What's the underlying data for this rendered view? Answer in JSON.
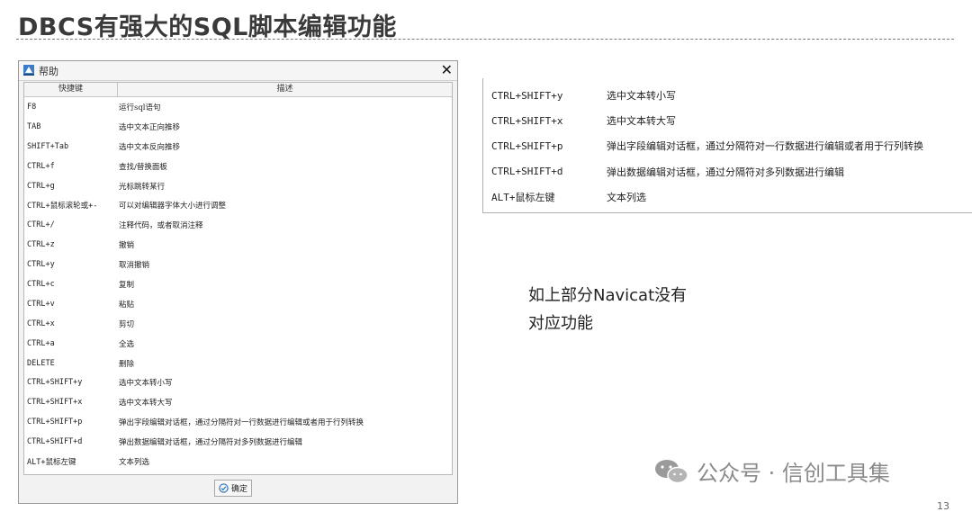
{
  "slide": {
    "title": "DBCS有强大的SQL脚本编辑功能",
    "note_line1": "如上部分Navicat没有",
    "note_line2": "对应功能",
    "watermark": "公众号 · 信创工具集",
    "page_number": "13"
  },
  "dialog": {
    "title": "帮助",
    "close_glyph": "✕",
    "header_key": "快捷键",
    "header_desc": "描述",
    "ok_label": "确定",
    "rows": [
      {
        "key": "F8",
        "desc": "运行sql语句"
      },
      {
        "key": "TAB",
        "desc": "选中文本正向推移"
      },
      {
        "key": "SHIFT+Tab",
        "desc": "选中文本反向推移"
      },
      {
        "key": "CTRL+f",
        "desc": "查找/替换面板"
      },
      {
        "key": "CTRL+g",
        "desc": "光标跳转某行"
      },
      {
        "key": "CTRL+鼠标滚轮或+-",
        "desc": "可以对编辑器字体大小进行调整"
      },
      {
        "key": "CTRL+/",
        "desc": "注释代码，或者取消注释"
      },
      {
        "key": "CTRL+z",
        "desc": "撤销"
      },
      {
        "key": "CTRL+y",
        "desc": "取消撤销"
      },
      {
        "key": "CTRL+c",
        "desc": "复制"
      },
      {
        "key": "CTRL+v",
        "desc": "粘贴"
      },
      {
        "key": "CTRL+x",
        "desc": "剪切"
      },
      {
        "key": "CTRL+a",
        "desc": "全选"
      },
      {
        "key": "DELETE",
        "desc": "删除"
      },
      {
        "key": "CTRL+SHIFT+y",
        "desc": "选中文本转小写"
      },
      {
        "key": "CTRL+SHIFT+x",
        "desc": "选中文本转大写"
      },
      {
        "key": "CTRL+SHIFT+p",
        "desc": "弹出字段编辑对话框，通过分隔符对一行数据进行编辑或者用于行列转换"
      },
      {
        "key": "CTRL+SHIFT+d",
        "desc": "弹出数据编辑对话框，通过分隔符对多列数据进行编辑"
      },
      {
        "key": "ALT+鼠标左键",
        "desc": "文本列选"
      }
    ]
  },
  "zoom": {
    "rows": [
      {
        "key": "CTRL+SHIFT+y",
        "desc": "选中文本转小写"
      },
      {
        "key": "CTRL+SHIFT+x",
        "desc": "选中文本转大写"
      },
      {
        "key": "CTRL+SHIFT+p",
        "desc": "弹出字段编辑对话框，通过分隔符对一行数据进行编辑或者用于行列转换"
      },
      {
        "key": "CTRL+SHIFT+d",
        "desc": "弹出数据编辑对话框，通过分隔符对多列数据进行编辑"
      },
      {
        "key": "ALT+鼠标左键",
        "desc": "文本列选"
      }
    ]
  },
  "colors": {
    "title_text": "#3a3a3a",
    "watermark_text": "#8a8a8a",
    "ok_icon": "#2f6fb0"
  },
  "icons": {
    "dialog_app": "dbcs-logo-icon",
    "ok": "check-circle-icon",
    "watermark": "wechat-icon"
  }
}
